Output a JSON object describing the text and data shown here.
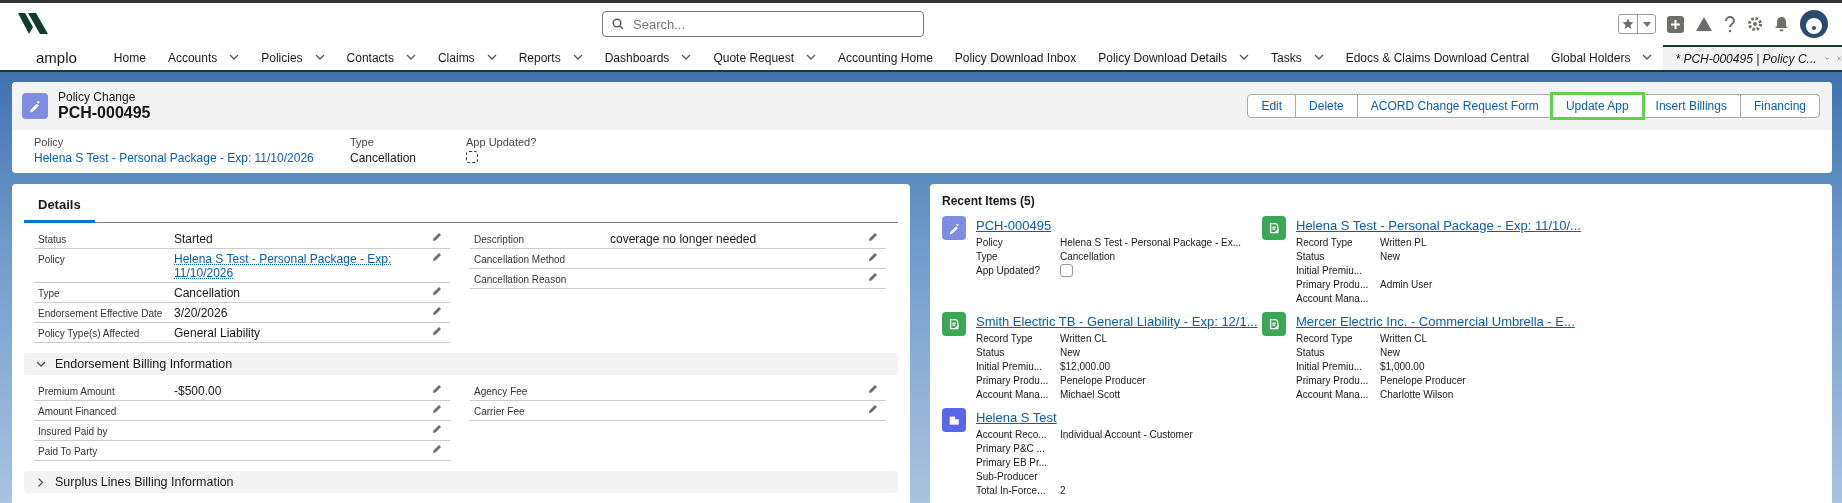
{
  "global_header": {
    "search": {
      "placeholder": "Search..."
    }
  },
  "nav": {
    "app_name": "amplo",
    "items": [
      {
        "label": "Home",
        "dropdown": false,
        "kind": "item",
        "selected": false
      },
      {
        "label": "Accounts",
        "dropdown": true,
        "kind": "item",
        "selected": false
      },
      {
        "label": "Policies",
        "dropdown": true,
        "kind": "item",
        "selected": false
      },
      {
        "label": "Contacts",
        "dropdown": true,
        "kind": "item",
        "selected": false
      },
      {
        "label": "Claims",
        "dropdown": true,
        "kind": "item",
        "selected": false
      },
      {
        "label": "Reports",
        "dropdown": true,
        "kind": "item",
        "selected": false
      },
      {
        "label": "Dashboards",
        "dropdown": true,
        "kind": "item",
        "selected": false
      },
      {
        "label": "Quote Request",
        "dropdown": true,
        "kind": "item",
        "selected": false
      },
      {
        "label": "Accounting Home",
        "dropdown": false,
        "kind": "item",
        "selected": false
      },
      {
        "label": "Policy Download Inbox",
        "dropdown": false,
        "kind": "item",
        "selected": false
      },
      {
        "label": "Policy Download Details",
        "dropdown": true,
        "kind": "item",
        "selected": false
      },
      {
        "label": "Tasks",
        "dropdown": true,
        "kind": "item",
        "selected": false
      },
      {
        "label": "Edocs & Claims Download Central",
        "dropdown": false,
        "kind": "item",
        "selected": false
      },
      {
        "label": "Global Holders",
        "dropdown": true,
        "kind": "item",
        "selected": false
      },
      {
        "label": "* PCH-000495 | Policy C...",
        "dropdown": true,
        "kind": "record_tab",
        "selected": true
      }
    ]
  },
  "record_header": {
    "object_label": "Policy Change",
    "title": "PCH-000495",
    "actions": [
      {
        "label": "Edit",
        "highlighted": false
      },
      {
        "label": "Delete",
        "highlighted": false
      },
      {
        "label": "ACORD Change Request Form",
        "highlighted": false
      },
      {
        "label": "Update App",
        "highlighted": true
      },
      {
        "label": "Insert Billings",
        "highlighted": false
      },
      {
        "label": "Financing",
        "highlighted": false
      }
    ],
    "fields": [
      {
        "label": "Policy",
        "kind": "link",
        "value": "Helena S Test - Personal Package - Exp: 11/10/2026"
      },
      {
        "label": "Type",
        "kind": "text",
        "value": "Cancellation"
      },
      {
        "label": "App Updated?",
        "kind": "checkbox",
        "checked": false
      }
    ]
  },
  "details": {
    "tabs": [
      {
        "label": "Details",
        "selected": true
      }
    ],
    "sections": [
      {
        "left": [
          {
            "label": "Status",
            "value": "Started",
            "kind": "text"
          },
          {
            "label": "Policy",
            "value": "Helena S Test - Personal Package - Exp: 11/10/2026",
            "kind": "link"
          },
          {
            "label": "Type",
            "value": "Cancellation",
            "kind": "text"
          },
          {
            "label": "Endorsement Effective Date",
            "value": "3/20/2026",
            "kind": "text"
          },
          {
            "label": "Policy Type(s) Affected",
            "value": "General Liability",
            "kind": "text"
          }
        ],
        "right": [
          {
            "label": "Description",
            "value": "coverage no longer needed",
            "kind": "text"
          },
          {
            "label": "Cancellation Method",
            "kind": "text"
          },
          {
            "label": "Cancellation Reason",
            "kind": "text"
          }
        ]
      },
      {
        "title": "Endorsement Billing Information",
        "expanded": true,
        "left": [
          {
            "label": "Premium Amount",
            "value": "-$500.00",
            "kind": "text"
          },
          {
            "label": "Amount Financed",
            "kind": "text"
          },
          {
            "label": "Insured Paid by",
            "kind": "text"
          },
          {
            "label": "Paid To Party",
            "kind": "text"
          }
        ],
        "right": [
          {
            "label": "Agency Fee",
            "kind": "text"
          },
          {
            "label": "Carrier Fee",
            "kind": "text"
          }
        ]
      },
      {
        "title": "Surplus Lines Billing Information",
        "expanded": false
      }
    ]
  },
  "recent_items": {
    "title": "Recent Items (5)",
    "items": [
      {
        "kind": "policy_change",
        "title": "PCH-000495",
        "fields": [
          {
            "label": "Policy",
            "value": "Helena S Test - Personal Package - Ex..."
          },
          {
            "label": "Type",
            "value": "Cancellation"
          },
          {
            "label": "App Updated?",
            "kind": "checkbox",
            "checked": false
          }
        ]
      },
      {
        "kind": "policy",
        "title": "Helena S Test - Personal Package - Exp: 11/10/...",
        "fields": [
          {
            "label": "Record Type",
            "value": "Written PL"
          },
          {
            "label": "Status",
            "value": "New"
          },
          {
            "label": "Initial Premiu..."
          },
          {
            "label": "Primary Produ...",
            "value": "Admin User"
          },
          {
            "label": "Account Mana..."
          }
        ]
      },
      {
        "kind": "policy",
        "title": "Smith Electric TB - General Liability - Exp: 12/1...",
        "fields": [
          {
            "label": "Record Type",
            "value": "Written CL"
          },
          {
            "label": "Status",
            "value": "New"
          },
          {
            "label": "Initial Premiu...",
            "value": "$12,000.00"
          },
          {
            "label": "Primary Produ...",
            "value": "Penelope Producer"
          },
          {
            "label": "Account Mana...",
            "value": "Michael Scott"
          }
        ]
      },
      {
        "kind": "policy",
        "title": "Mercer Electric Inc. - Commercial Umbrella - E...",
        "fields": [
          {
            "label": "Record Type",
            "value": "Written CL"
          },
          {
            "label": "Status",
            "value": "New"
          },
          {
            "label": "Initial Premiu...",
            "value": "$1,000.00"
          },
          {
            "label": "Primary Produ...",
            "value": "Penelope Producer"
          },
          {
            "label": "Account Mana...",
            "value": "Charlotte Wilson"
          }
        ]
      },
      {
        "kind": "account",
        "title": "Helena S Test",
        "fields": [
          {
            "label": "Account Reco...",
            "value": "Individual Account - Customer"
          },
          {
            "label": "Primary P&C ..."
          },
          {
            "label": "Primary EB Pr..."
          },
          {
            "label": "Sub-Producer"
          },
          {
            "label": "Total In-Force...",
            "value": "2"
          }
        ]
      }
    ]
  }
}
